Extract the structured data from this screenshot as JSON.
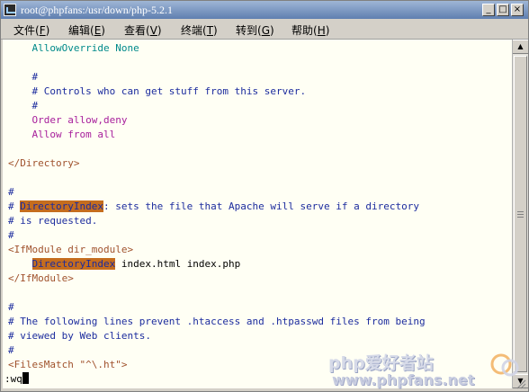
{
  "window": {
    "title": "root@phpfans:/usr/down/php-5.2.1",
    "controls": {
      "minimize": "_",
      "maximize": "□",
      "close": "×"
    }
  },
  "menu": {
    "items": [
      {
        "label": "文件",
        "key": "F"
      },
      {
        "label": "编辑",
        "key": "E"
      },
      {
        "label": "查看",
        "key": "V"
      },
      {
        "label": "终端",
        "key": "T"
      },
      {
        "label": "转到",
        "key": "G"
      },
      {
        "label": "帮助",
        "key": "H"
      }
    ]
  },
  "terminal": {
    "lines": {
      "l1": "    AllowOverride None",
      "l3": "    #",
      "l4": "    # Controls who can get stuff from this server.",
      "l5": "    #",
      "l6": "    Order allow,deny",
      "l7": "    Allow from all",
      "l9": "</Directory>",
      "l11": "#",
      "l12_hl": "DirectoryIndex",
      "l12_pre": "# ",
      "l12_post": ": sets the file that Apache will serve if a directory",
      "l13": "# is requested.",
      "l14": "#",
      "l15": "<IfModule dir_module>",
      "l16_pre": "    ",
      "l16_hl": "DirectoryIndex",
      "l16_post": " index.html index.php",
      "l17": "</IfModule>",
      "l19": "#",
      "l20": "# The following lines prevent .htaccess and .htpasswd files from being",
      "l21": "# viewed by Web clients.",
      "l22": "#",
      "l23": "<FilesMatch \"^\\.ht\">",
      "cmd": ":wq"
    }
  },
  "watermark": {
    "text": "php爱好者站",
    "url": "www.phpfans.net"
  },
  "colors": {
    "teal": "#008a8a",
    "blue": "#1c2c9e",
    "purple": "#a8209c",
    "brown": "#a0522d",
    "highlight": "#c56d1e",
    "background": "#fffff4"
  }
}
